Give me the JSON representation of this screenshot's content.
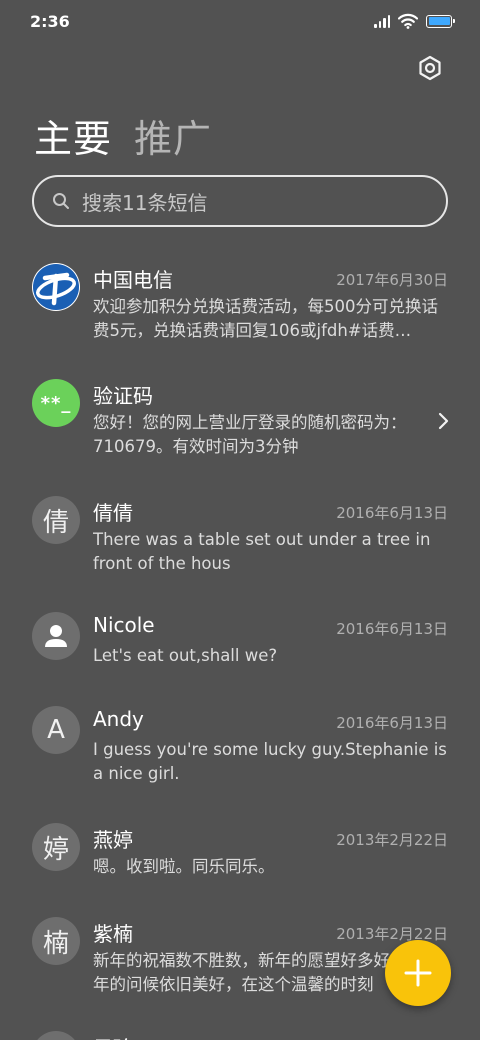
{
  "status_bar": {
    "time": "2:36"
  },
  "tabs": {
    "main": "主要",
    "promo": "推广"
  },
  "search": {
    "placeholder": "搜索11条短信"
  },
  "conversations": [
    {
      "name": "中国电信",
      "date": "2017年6月30日",
      "preview": "欢迎参加积分兑换话费活动，每500分可兑换话费5元，兑换话费请回复106或jfdh#话费…",
      "avatar": "china-telecom-logo"
    },
    {
      "name": "验证码",
      "date": "",
      "preview": "您好！您的网上营业厅登录的随机密码为：710679。有效时间为3分钟",
      "avatar_text": "**_"
    },
    {
      "name": "倩倩",
      "date": "2016年6月13日",
      "preview": "There was a table set out under a tree in front of the hous",
      "avatar_text": "倩"
    },
    {
      "name": "Nicole",
      "date": "2016年6月13日",
      "preview": "Let's eat out,shall we?",
      "avatar": "person-icon"
    },
    {
      "name": "Andy",
      "date": "2016年6月13日",
      "preview": "I guess you're some lucky guy.Stephanie is a nice girl.",
      "avatar_text": "A"
    },
    {
      "name": "燕婷",
      "date": "2013年2月22日",
      "preview": "嗯。收到啦。同乐同乐。",
      "avatar_text": "婷"
    },
    {
      "name": "紫楠",
      "date": "2013年2月22日",
      "preview": "新年的祝福数不胜数，新年的愿望好多好多，新年的问候依旧美好，在这个温馨的时刻",
      "avatar_text": "楠"
    },
    {
      "name": "子玲",
      "date": "",
      "preview": "",
      "avatar_text": ""
    }
  ],
  "colors": {
    "background": "#525252",
    "fab": "#f9c30a",
    "verification_avatar": "#6bd15a",
    "battery": "#3fa9ff"
  }
}
